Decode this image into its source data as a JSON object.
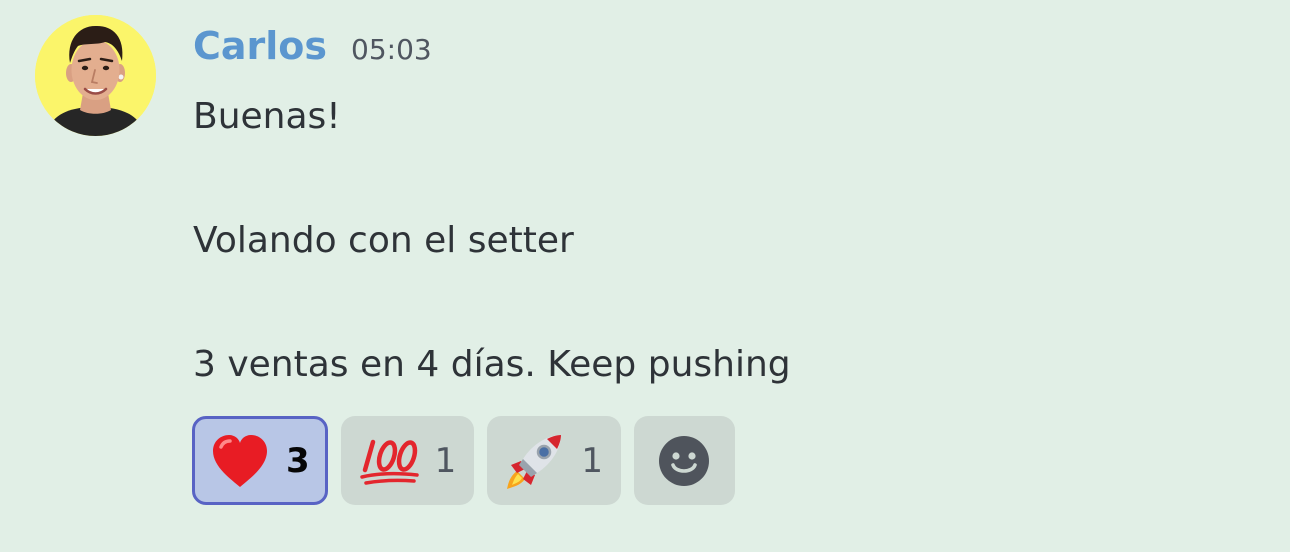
{
  "message": {
    "author": "Carlos",
    "timestamp": "05:03",
    "lines": [
      "Buenas!",
      "",
      "Volando con el setter",
      "",
      "3 ventas en 4 días. Keep pushing"
    ],
    "author_color": "#5b96cf",
    "avatar_background": "#fbf56a"
  },
  "reactions": [
    {
      "emoji": "heart",
      "emoji_icon": "red-heart-icon",
      "count": "3",
      "selected": true
    },
    {
      "emoji": "100",
      "emoji_icon": "hundred-points-icon",
      "count": "1",
      "selected": false
    },
    {
      "emoji": "rocket",
      "emoji_icon": "rocket-icon",
      "count": "1",
      "selected": false
    }
  ],
  "add_reaction": {
    "icon": "smiley-face-icon"
  },
  "colors": {
    "background": "#e1efe6",
    "reaction_background": "#cdd8d2",
    "selected_reaction_background": "#b8c6e6",
    "selected_reaction_border": "#5863c4"
  }
}
